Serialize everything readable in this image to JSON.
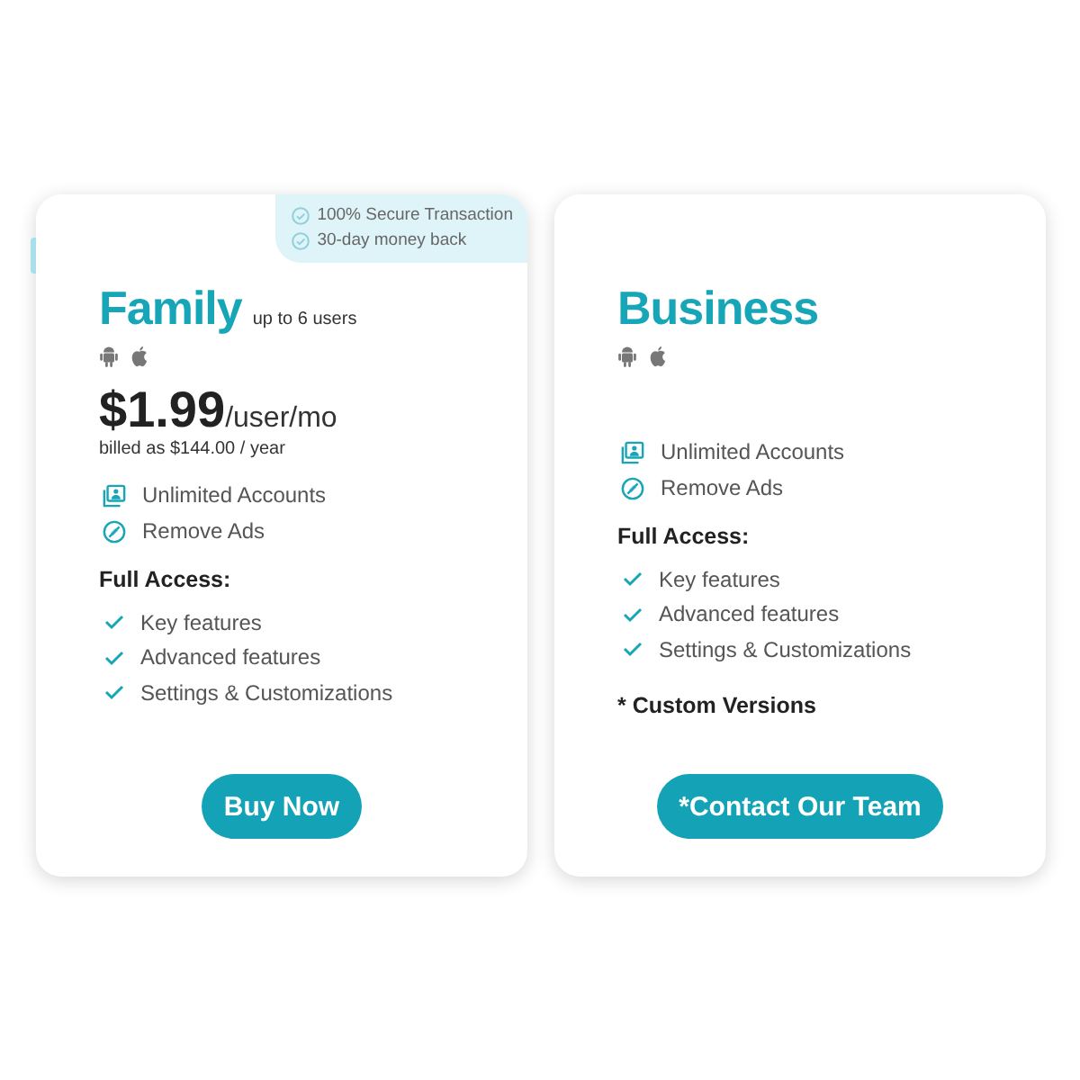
{
  "plans": [
    {
      "title": "Family",
      "subtitle": "up to 6 users",
      "guarantees": [
        "100% Secure Transaction",
        "30-day money back"
      ],
      "price": {
        "amount": "$1.99",
        "unit": "/user/mo",
        "billing": "billed as $144.00 / year"
      },
      "features": [
        {
          "kind": "accounts",
          "label": "Unlimited Accounts"
        },
        {
          "kind": "no-ads",
          "label": "Remove Ads"
        }
      ],
      "access_heading": "Full Access:",
      "access_items": [
        "Key features",
        "Advanced features",
        "Settings & Customizations"
      ],
      "button": "Buy Now"
    },
    {
      "title": "Business",
      "features": [
        {
          "kind": "accounts",
          "label": "Unlimited Accounts"
        },
        {
          "kind": "no-ads",
          "label": "Remove Ads"
        }
      ],
      "access_heading": "Full Access:",
      "access_items": [
        "Key features",
        "Advanced features",
        "Settings & Customizations"
      ],
      "note": "* Custom Versions",
      "button": "*Contact Our Team"
    }
  ]
}
